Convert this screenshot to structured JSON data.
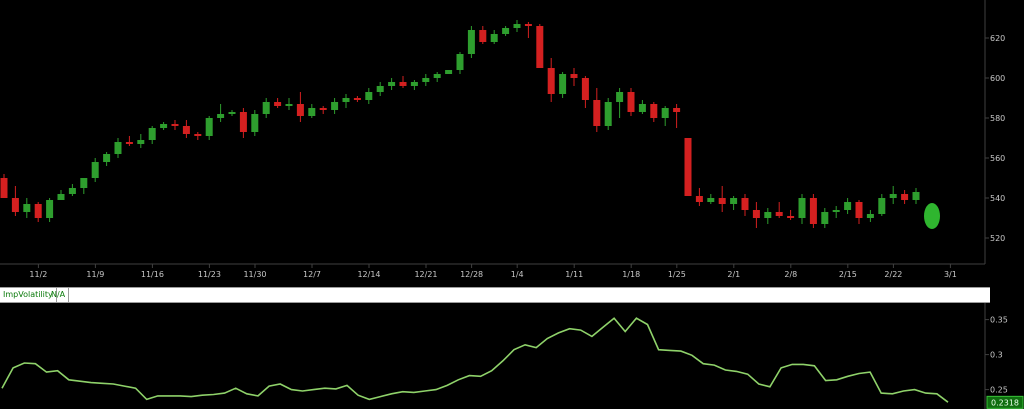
{
  "colors": {
    "background": "#000000",
    "up": "#2e9e2e",
    "down": "#d42020",
    "axis": "#404040",
    "label": "#c8c8c8",
    "iv_line": "#8fd26a",
    "current_marker": "#2fb52f"
  },
  "price_panel": {
    "y_ticks": [
      "620",
      "600",
      "580",
      "560",
      "540",
      "520"
    ],
    "y_values": [
      620,
      600,
      580,
      560,
      540,
      520
    ],
    "ylim": [
      510,
      633
    ],
    "x_tick_labels": [
      "11/2",
      "11/9",
      "11/16",
      "11/23",
      "11/30",
      "12/7",
      "12/14",
      "12/21",
      "12/28",
      "1/4",
      "1/11",
      "1/18",
      "1/25",
      "2/1",
      "2/8",
      "2/15",
      "2/22",
      "3/1"
    ],
    "x_tick_index": [
      1,
      6,
      11,
      16,
      20,
      25,
      30,
      35,
      39,
      43,
      48,
      53,
      57,
      62,
      67,
      72,
      76,
      81
    ]
  },
  "iv_panel": {
    "header": {
      "name": "ImpVolatility",
      "value": "N/A"
    },
    "y_ticks": [
      "0.35",
      "0.3",
      "0.25"
    ],
    "y_values": [
      0.35,
      0.3,
      0.25
    ],
    "ylim": [
      0.228,
      0.368
    ],
    "current_value": "0.2318"
  },
  "chart_data": [
    {
      "type": "candlestick",
      "title": "",
      "xlabel": "",
      "ylabel": "",
      "ylim": [
        510,
        633
      ],
      "x_tick_labels": [
        "11/2",
        "11/9",
        "11/16",
        "11/23",
        "11/30",
        "12/7",
        "12/14",
        "12/21",
        "12/28",
        "1/4",
        "1/11",
        "1/18",
        "1/25",
        "2/1",
        "2/8",
        "2/15",
        "2/22",
        "3/1"
      ],
      "candles": [
        [
          550,
          552,
          540,
          540
        ],
        [
          540,
          546,
          531,
          533
        ],
        [
          533,
          540,
          530,
          537
        ],
        [
          537,
          538,
          528,
          530
        ],
        [
          530,
          540,
          528,
          539
        ],
        [
          539,
          544,
          539,
          542
        ],
        [
          542,
          547,
          541,
          545
        ],
        [
          545,
          550,
          542,
          550
        ],
        [
          550,
          560,
          548,
          558
        ],
        [
          558,
          563,
          556,
          562
        ],
        [
          562,
          570,
          560,
          568
        ],
        [
          568,
          571,
          566,
          567
        ],
        [
          567,
          572,
          565,
          569
        ],
        [
          569,
          576,
          567,
          575
        ],
        [
          575,
          578,
          574,
          577
        ],
        [
          577,
          579,
          574,
          576
        ],
        [
          576,
          579,
          570,
          572
        ],
        [
          572,
          573,
          569,
          571
        ],
        [
          571,
          581,
          569,
          580
        ],
        [
          580,
          587,
          578,
          582
        ],
        [
          582,
          584,
          581,
          583
        ],
        [
          583,
          585,
          570,
          573
        ],
        [
          573,
          584,
          571,
          582
        ],
        [
          582,
          590,
          580,
          588
        ],
        [
          588,
          590,
          585,
          586
        ],
        [
          586,
          590,
          584,
          587
        ],
        [
          587,
          593,
          578,
          581
        ],
        [
          581,
          587,
          580,
          585
        ],
        [
          585,
          586,
          582,
          584
        ],
        [
          584,
          590,
          582,
          588
        ],
        [
          588,
          592,
          585,
          590
        ],
        [
          590,
          591,
          588,
          589
        ],
        [
          589,
          595,
          587,
          593
        ],
        [
          593,
          598,
          591,
          596
        ],
        [
          596,
          600,
          594,
          598
        ],
        [
          598,
          601,
          595,
          596
        ],
        [
          596,
          599,
          594,
          598
        ],
        [
          598,
          602,
          596,
          600
        ],
        [
          600,
          603,
          598,
          602
        ],
        [
          602,
          604,
          603,
          604
        ],
        [
          604,
          613,
          602,
          612
        ],
        [
          612,
          626,
          610,
          624
        ],
        [
          624,
          626,
          617,
          618
        ],
        [
          618,
          624,
          617,
          622
        ],
        [
          622,
          626,
          621,
          625
        ],
        [
          625,
          629,
          623,
          627
        ],
        [
          627,
          628,
          620,
          626
        ],
        [
          626,
          627,
          605,
          605
        ],
        [
          605,
          610,
          588,
          592
        ],
        [
          592,
          603,
          590,
          602
        ],
        [
          602,
          605,
          596,
          600
        ],
        [
          600,
          601,
          585,
          589
        ],
        [
          589,
          595,
          573,
          576
        ],
        [
          576,
          590,
          574,
          588
        ],
        [
          588,
          595,
          580,
          593
        ],
        [
          593,
          595,
          581,
          583
        ],
        [
          583,
          589,
          582,
          587
        ],
        [
          587,
          588,
          578,
          580
        ],
        [
          580,
          586,
          576,
          585
        ],
        [
          585,
          587,
          575,
          583
        ],
        [
          570,
          570,
          541,
          541
        ],
        [
          541,
          545,
          536,
          538
        ],
        [
          538,
          542,
          537,
          540
        ],
        [
          540,
          546,
          533,
          537
        ],
        [
          537,
          541,
          534,
          540
        ],
        [
          540,
          542,
          531,
          534
        ],
        [
          534,
          538,
          525,
          530
        ],
        [
          530,
          535,
          527,
          533
        ],
        [
          533,
          538,
          530,
          531
        ],
        [
          531,
          534,
          529,
          530
        ],
        [
          530,
          542,
          527,
          540
        ],
        [
          540,
          542,
          525,
          527
        ],
        [
          527,
          535,
          525,
          533
        ],
        [
          533,
          536,
          530,
          534
        ],
        [
          534,
          540,
          532,
          538
        ],
        [
          538,
          539,
          527,
          530
        ],
        [
          530,
          534,
          528,
          532
        ],
        [
          532,
          542,
          531,
          540
        ],
        [
          540,
          546,
          537,
          542
        ],
        [
          542,
          544,
          537,
          539
        ],
        [
          539,
          545,
          537,
          543
        ]
      ],
      "current_value": 531
    },
    {
      "type": "line",
      "title": "ImpVolatility",
      "xlabel": "",
      "ylabel": "",
      "ylim": [
        0.228,
        0.368
      ],
      "series": [
        {
          "name": "ImpVolatility",
          "values": [
            0.252,
            0.281,
            0.288,
            0.287,
            0.275,
            0.277,
            0.264,
            0.262,
            0.26,
            0.259,
            0.258,
            0.255,
            0.252,
            0.236,
            0.241,
            0.241,
            0.241,
            0.24,
            0.242,
            0.243,
            0.245,
            0.252,
            0.244,
            0.241,
            0.255,
            0.258,
            0.25,
            0.248,
            0.25,
            0.252,
            0.251,
            0.256,
            0.242,
            0.236,
            0.24,
            0.244,
            0.247,
            0.246,
            0.248,
            0.25,
            0.256,
            0.264,
            0.27,
            0.269,
            0.277,
            0.291,
            0.307,
            0.314,
            0.31,
            0.323,
            0.331,
            0.337,
            0.335,
            0.326,
            0.339,
            0.352,
            0.333,
            0.352,
            0.343,
            0.307,
            0.306,
            0.305,
            0.299,
            0.287,
            0.285,
            0.278,
            0.276,
            0.272,
            0.258,
            0.254,
            0.281,
            0.286,
            0.286,
            0.284,
            0.263,
            0.264,
            0.269,
            0.273,
            0.275,
            0.245,
            0.244,
            0.248,
            0.25,
            0.245,
            0.244,
            0.232
          ]
        }
      ]
    }
  ]
}
